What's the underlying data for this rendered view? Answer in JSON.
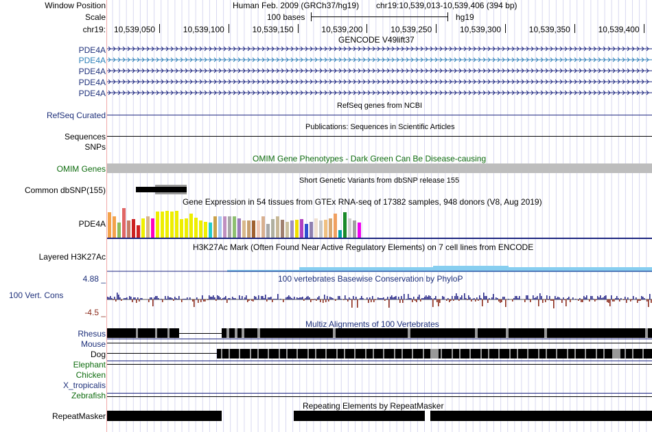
{
  "header": {
    "window_position_label": "Window Position",
    "scale_label": "Scale",
    "chrom_label": "chr19:",
    "assembly": "Human Feb. 2009 (GRCh37/hg19)",
    "region": "chr19:10,539,013-10,539,406 (394 bp)",
    "scale_text": "100 bases",
    "db": "hg19",
    "ticks": [
      "10,539,050",
      "10,539,100",
      "10,539,150",
      "10,539,200",
      "10,539,250",
      "10,539,300",
      "10,539,350",
      "10,539,400"
    ]
  },
  "tracks": {
    "gencode_title": "GENCODE V49lift37",
    "gencode_labels": [
      "PDE4A",
      "PDE4A",
      "PDE4A",
      "PDE4A",
      "PDE4A"
    ],
    "refseq_label": "RefSeq Curated",
    "refseq_title": "RefSeq genes from NCBI",
    "pubs_title": "Publications: Sequences in Scientific Articles",
    "sequences_label": "Sequences",
    "snps_label": "SNPs",
    "omim_title": "OMIM Gene Phenotypes - Dark Green Can Be Disease-causing",
    "omim_label": "OMIM Genes",
    "dbsnp_title": "Short Genetic Variants from dbSNP release 155",
    "dbsnp_label": "Common dbSNP(155)",
    "gtex_title": "Gene Expression in 54 tissues from GTEx RNA-seq of 17382 samples, 948 donors (V8, Aug 2019)",
    "gtex_label": "PDE4A",
    "h3k_title": "H3K27Ac Mark (Often Found Near Active Regulatory Elements) on 7 cell lines from ENCODE",
    "h3k_label": "Layered H3K27Ac",
    "cons_title": "100 vertebrates Basewise Conservation by PhyloP",
    "cons_label": "100 Vert. Cons",
    "cons_max": "4.88 _",
    "cons_min": "-4.5 _",
    "multiz_title": "Multiz Alignments of 100 Vertebrates",
    "species": [
      "Rhesus",
      "Mouse",
      "Dog",
      "Elephant",
      "Chicken",
      "X_tropicalis",
      "Zebrafish"
    ],
    "rmsk_title": "Repeating Elements by RepeatMasker",
    "rmsk_label": "RepeatMasker"
  },
  "colors": {
    "label_blue": "#1d2f7a",
    "gene_navy": "#1a237e",
    "gene_light": "#2c7fb8",
    "omim_gray": "#bdbdbd",
    "cons_pos": "#2a2a8a",
    "cons_neg": "#8b2a1a",
    "h3k_fill": "#87cef0",
    "guide_line": "#d8d8f0"
  },
  "gtex_bars": [
    {
      "c": "#f4a24a",
      "v": 0.82
    },
    {
      "c": "#f4a24a",
      "v": 0.7
    },
    {
      "c": "#8fbc5a",
      "v": 0.48
    },
    {
      "c": "#e06666",
      "v": 0.95
    },
    {
      "c": "#c77c64",
      "v": 0.55
    },
    {
      "c": "#cc2222",
      "v": 0.6
    },
    {
      "c": "#d02020",
      "v": 0.4
    },
    {
      "c": "#f0f000",
      "v": 0.62
    },
    {
      "c": "#d7b48a",
      "v": 0.68
    },
    {
      "c": "#ff00c0",
      "v": 0.62
    },
    {
      "c": "#eeee00",
      "v": 0.85
    },
    {
      "c": "#eeee00",
      "v": 0.85
    },
    {
      "c": "#eeee00",
      "v": 0.87
    },
    {
      "c": "#eeee00",
      "v": 0.85
    },
    {
      "c": "#eeee00",
      "v": 0.87
    },
    {
      "c": "#eeee00",
      "v": 0.6
    },
    {
      "c": "#eeee00",
      "v": 0.62
    },
    {
      "c": "#eeee00",
      "v": 0.77
    },
    {
      "c": "#eeee00",
      "v": 0.65
    },
    {
      "c": "#eeee00",
      "v": 0.55
    },
    {
      "c": "#f0f000",
      "v": 0.5
    },
    {
      "c": "#22cccc",
      "v": 0.48
    },
    {
      "c": "#caa24a",
      "v": 0.68
    },
    {
      "c": "#a8c8f0",
      "v": 0.68
    },
    {
      "c": "#c090c0",
      "v": 0.68
    },
    {
      "c": "#a8a8a8",
      "v": 0.68
    },
    {
      "c": "#8ec070",
      "v": 0.68
    },
    {
      "c": "#9c7cbc",
      "v": 0.62
    },
    {
      "c": "#d8b88c",
      "v": 0.55
    },
    {
      "c": "#c8a070",
      "v": 0.55
    },
    {
      "c": "#a06030",
      "v": 0.55
    },
    {
      "c": "#f0c8b8",
      "v": 0.55
    },
    {
      "c": "#d8b090",
      "v": 0.68
    },
    {
      "c": "#a8a8a8",
      "v": 0.45
    },
    {
      "c": "#b0b0a0",
      "v": 0.6
    },
    {
      "c": "#c8b898",
      "v": 0.68
    },
    {
      "c": "#a08070",
      "v": 0.58
    },
    {
      "c": "#ccc0a0",
      "v": 0.5
    },
    {
      "c": "#a090c0",
      "v": 0.55
    },
    {
      "c": "#f0e000",
      "v": 0.58
    },
    {
      "c": "#b040c0",
      "v": 0.6
    },
    {
      "c": "#3050d0",
      "v": 0.45
    },
    {
      "c": "#9080b0",
      "v": 0.52
    },
    {
      "c": "#f0e0d0",
      "v": 0.62
    },
    {
      "c": "#c8c8c8",
      "v": 0.55
    },
    {
      "c": "#f0c080",
      "v": 0.58
    },
    {
      "c": "#d8a870",
      "v": 0.62
    },
    {
      "c": "#f0a060",
      "v": 0.78
    },
    {
      "c": "#00a0a0",
      "v": 0.25
    },
    {
      "c": "#1a8a2a",
      "v": 0.82
    },
    {
      "c": "#d0d0d0",
      "v": 0.62
    },
    {
      "c": "#a0a0a0",
      "v": 0.55
    },
    {
      "c": "#f000f0",
      "v": 0.48
    }
  ]
}
